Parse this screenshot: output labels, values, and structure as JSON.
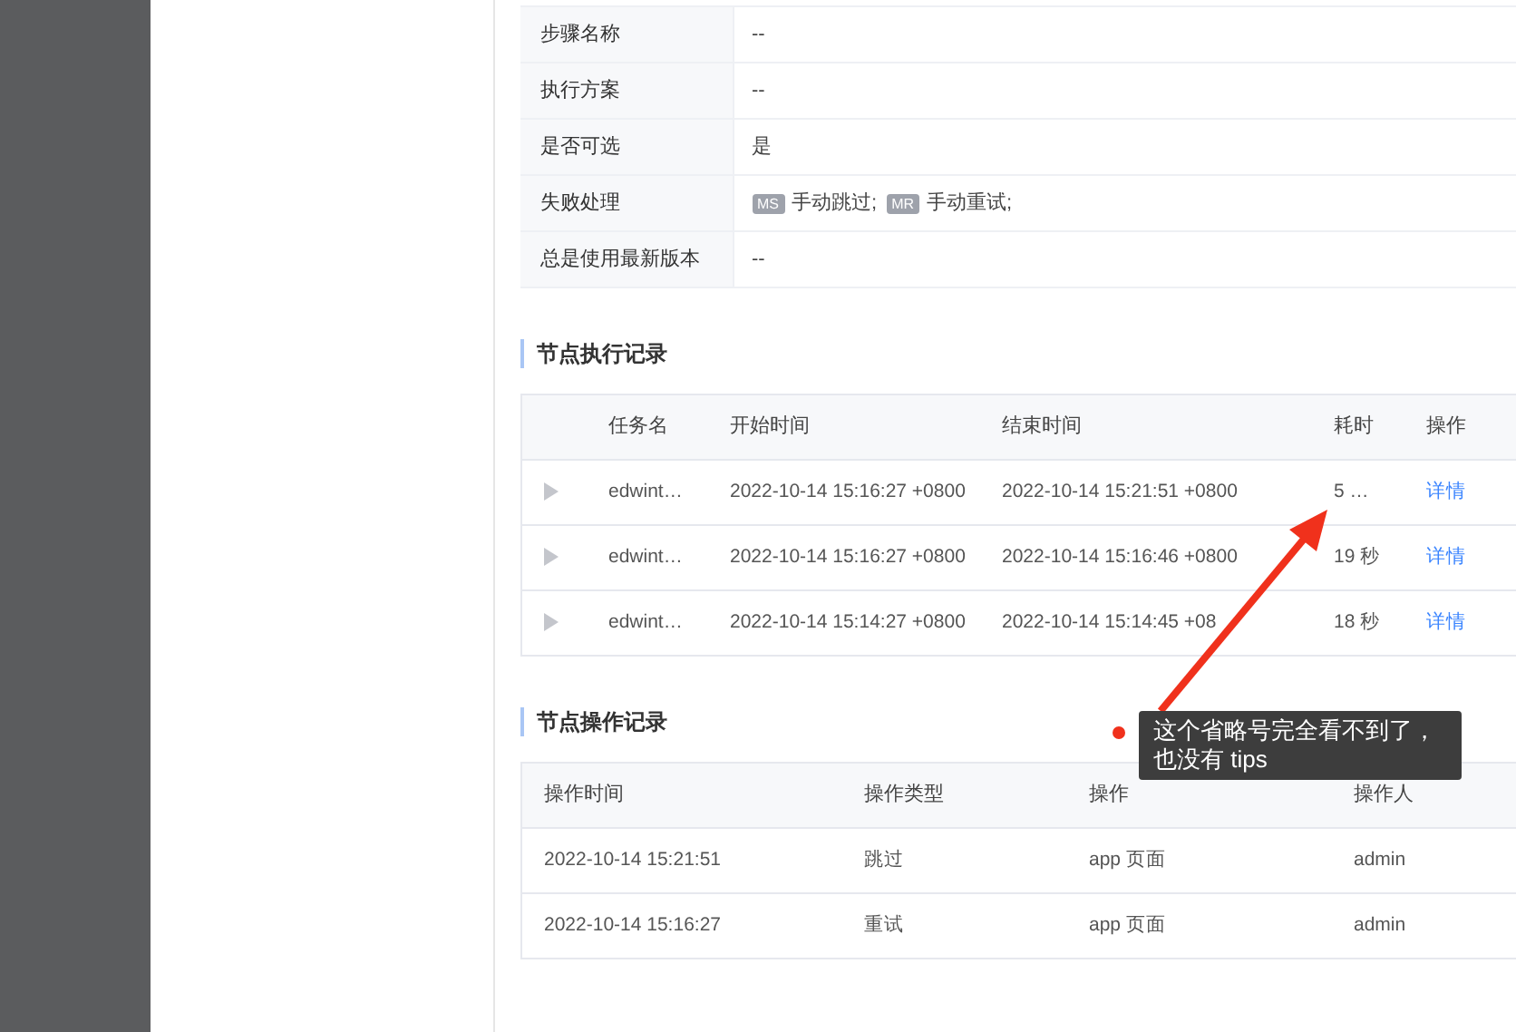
{
  "detail_rows": [
    {
      "label": "步骤名称",
      "value": "--"
    },
    {
      "label": "执行方案",
      "value": "--"
    },
    {
      "label": "是否可选",
      "value": "是"
    },
    {
      "label": "失败处理",
      "tags": [
        {
          "tag": "MS",
          "text": "手动跳过;"
        },
        {
          "tag": "MR",
          "text": "手动重试;"
        }
      ]
    },
    {
      "label": "总是使用最新版本",
      "value": "--"
    }
  ],
  "exec_section": {
    "title": "节点执行记录",
    "columns": [
      "任务名",
      "开始时间",
      "结束时间",
      "耗时",
      "操作"
    ],
    "rows": [
      {
        "expanded": false,
        "task": "edwint…",
        "start": "2022-10-14 15:16:27 +0800",
        "end": "2022-10-14 15:21:51 +0800",
        "duration": "5 …",
        "action": "详情"
      },
      {
        "expanded": false,
        "task": "edwint…",
        "start": "2022-10-14 15:16:27 +0800",
        "end": "2022-10-14 15:16:46 +0800",
        "duration": "19 秒",
        "action": "详情"
      },
      {
        "expanded": false,
        "task": "edwint…",
        "start": "2022-10-14 15:14:27 +0800",
        "end": "2022-10-14 15:14:45 +08",
        "duration": "18 秒",
        "action": "详情"
      }
    ]
  },
  "op_section": {
    "title": "节点操作记录",
    "columns": [
      "操作时间",
      "操作类型",
      "操作",
      "操作人"
    ],
    "rows": [
      {
        "time": "2022-10-14 15:21:51",
        "type": "跳过",
        "source": "app 页面",
        "operator": "admin"
      },
      {
        "time": "2022-10-14 15:16:27",
        "type": "重试",
        "source": "app 页面",
        "operator": "admin"
      }
    ]
  },
  "annotation": {
    "text": "这个省略号完全看不到了，也没有 tips"
  }
}
